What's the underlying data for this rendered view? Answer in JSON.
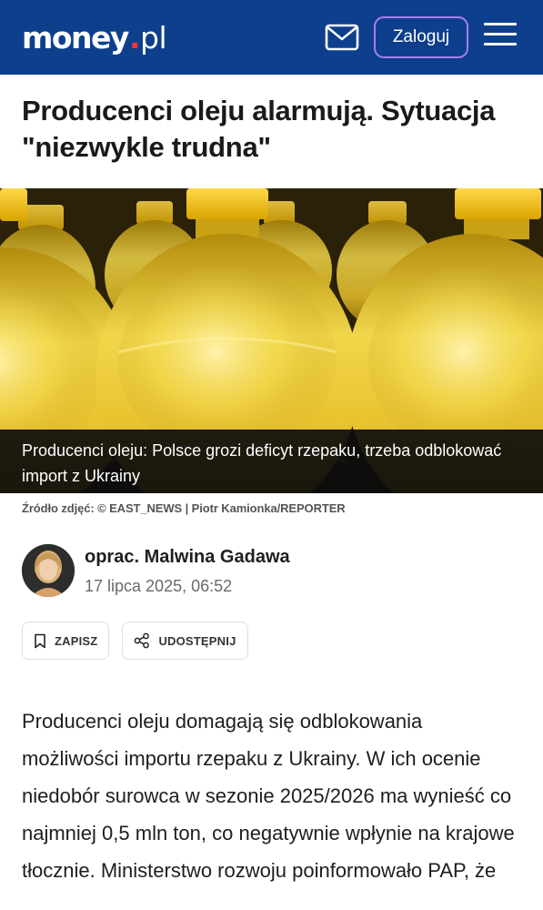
{
  "header": {
    "logo_main": "money",
    "logo_dot": ".",
    "logo_tld": "pl",
    "login_label": "Zaloguj",
    "mail_icon": "envelope-icon",
    "menu_icon": "hamburger-menu-icon",
    "bg_color": "#0d3f8d",
    "accent_color": "#a77ef0"
  },
  "article": {
    "title": "Producenci oleju alarmują. Sytuacja \"niezwykle trudna\"",
    "image_caption": "Producenci oleju: Polsce grozi deficyt rzepaku, trzeba odblokować import z Ukrainy",
    "image_source_label": "Źródło zdjęć:",
    "image_source": "© EAST_NEWS | Piotr Kamionka/REPORTER",
    "author": "oprac. Malwina Gadawa",
    "date": "17 lipca 2025, 06:52",
    "actions": {
      "save_label": "ZAPISZ",
      "save_icon": "bookmark-icon",
      "share_label": "UDOSTĘPNIJ",
      "share_icon": "share-icon"
    },
    "lead": "Producenci oleju domagają się odblokowania możliwości importu rzepaku z Ukrainy. W ich ocenie niedobór surowca w sezonie 2025/2026 ma wynieść co najmniej 0,5 mln ton, co negatywnie wpłynie na krajowe tłocznie. Ministerstwo rozwoju poinformowało PAP, że"
  }
}
